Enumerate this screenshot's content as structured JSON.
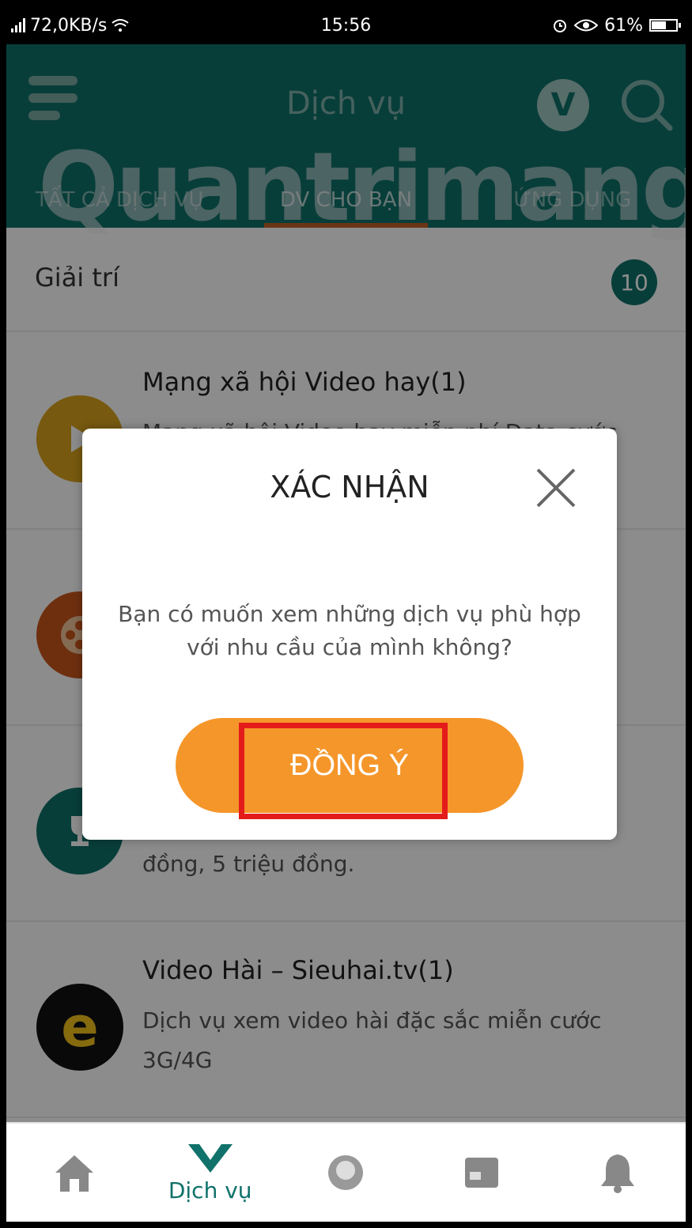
{
  "status_bar": {
    "network_speed": "72,0KB/s",
    "time": "15:56",
    "battery": "61%"
  },
  "header": {
    "title": "Dịch vụ",
    "tabs": [
      {
        "label": "TẤT CẢ DỊCH VỤ",
        "active": false
      },
      {
        "label": "DV CHO BẠN",
        "active": true
      },
      {
        "label": "ỨNG DỤNG",
        "active": false
      }
    ]
  },
  "watermark": {
    "text": "Quantrimang"
  },
  "section": {
    "label": "Giải trí",
    "count": "10"
  },
  "services": [
    {
      "name": "Mạng xã hội Video hay(1)",
      "desc": "Mạng xã hội Video hay miễn phí Data cước",
      "icon": "play-icon",
      "color": "#d9a21c"
    },
    {
      "name": "",
      "desc": "",
      "icon": "film-reel-icon",
      "color": "#c9561c"
    },
    {
      "name": "",
      "desc": "đồng, 5 triệu đồng.",
      "icon": "trophy-icon",
      "color": "#10726a"
    },
    {
      "name": "Video Hài – Sieuhai.tv(1)",
      "desc": "Dịch vụ xem video hài đặc sắc miễn cước 3G/4G",
      "icon": "sieuhai-logo-icon",
      "color": "#111111"
    }
  ],
  "dialog": {
    "title": "XÁC NHẬN",
    "message": "Bạn có muốn xem những dịch vụ phù hợp với nhu cầu của mình không?",
    "ok_label": "ĐỒNG Ý"
  },
  "bottom_nav": {
    "items": [
      {
        "icon": "home-icon",
        "label": ""
      },
      {
        "icon": "service-v-icon",
        "label": "Dịch vụ"
      },
      {
        "icon": "avatar-icon",
        "label": ""
      },
      {
        "icon": "store-icon",
        "label": ""
      },
      {
        "icon": "bell-icon",
        "label": ""
      }
    ]
  },
  "colors": {
    "brand": "#10726a",
    "accent": "#f5962a",
    "highlight": "#e41b1b"
  }
}
